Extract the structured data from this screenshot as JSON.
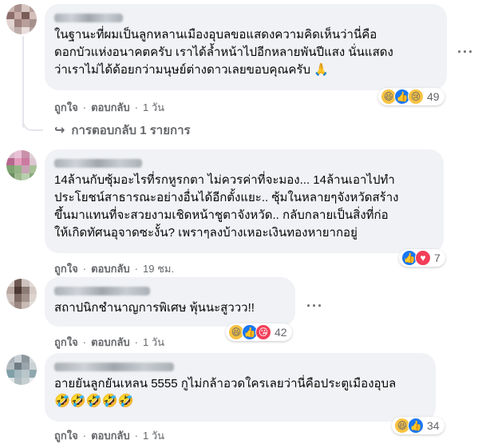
{
  "comments": [
    {
      "text": "ในฐานะที่ผมเป็นลูกหลานเมืองอุบลขอแสดงความคิดเห็นว่านี่คือ\nดอกบัวแห่งอนาคตครับ เราได้ล้ำหน้าไปอีกหลายพันปีแสง นั่นแสดง\nว่าเราไม่ได้ด้อยกว่ามนุษย์ต่างดาวเลยขอบคุณครับ 🙏",
      "like_label": "ถูกใจ",
      "reply_label": "ตอบกลับ",
      "time": "1 วัน",
      "reactions": [
        "haha-icon",
        "like-icon",
        "sad-icon"
      ],
      "reaction_count": "49",
      "replies_label": "การตอบกลับ 1 รายการ"
    },
    {
      "text": "14ล้านกับซุ้มอะไรที่รกหูรกตา ไม่ควรค่าที่จะมอง... 14ล้านเอาไปทำ\nประโยชน์สาธารณะอย่างอื่นได้อีกตั้งแยะ.. ซุ้มในหลายๆจังหวัดสร้าง\nขึ้นมาแทนที่จะสวยงามเชิดหน้าชูตาจังหวัด.. กลับกลายเป็นสิ่งที่ก่อ\nให้เกิดทัศนอุจาดซะงั้น? เพราๆลงบ้างเหอะเงินทองหายากอยู่",
      "like_label": "ถูกใจ",
      "reply_label": "ตอบกลับ",
      "time": "19 ชม.",
      "reactions": [
        "like-icon",
        "love-icon"
      ],
      "reaction_count": "7"
    },
    {
      "text": "สถาปนิกชำนาญการพิเศษ พุ้นนะสูววว!!",
      "like_label": "ถูกใจ",
      "reply_label": "ตอบกลับ",
      "time": "1 วัน",
      "reactions": [
        "haha-icon",
        "like-icon",
        "love-icon"
      ],
      "reaction_count": "42"
    },
    {
      "text": "อายยันลูกยันเหลน 5555 กูไม่กล้าอวดใครเลยว่านี่คือประตูเมืองอุบล",
      "emoji_line": "🤣🤣🤣🤣🤣",
      "like_label": "ถูกใจ",
      "reply_label": "ตอบกลับ",
      "time": "1 วัน",
      "reactions": [
        "haha-icon",
        "like-icon"
      ],
      "reaction_count": "34"
    }
  ],
  "colors": {
    "bubble": "#f0f2f5",
    "meta_text": "#65676b",
    "like_blue": "#1877f2",
    "love_red": "#f33e58",
    "haha_yellow": "#f7c242"
  }
}
